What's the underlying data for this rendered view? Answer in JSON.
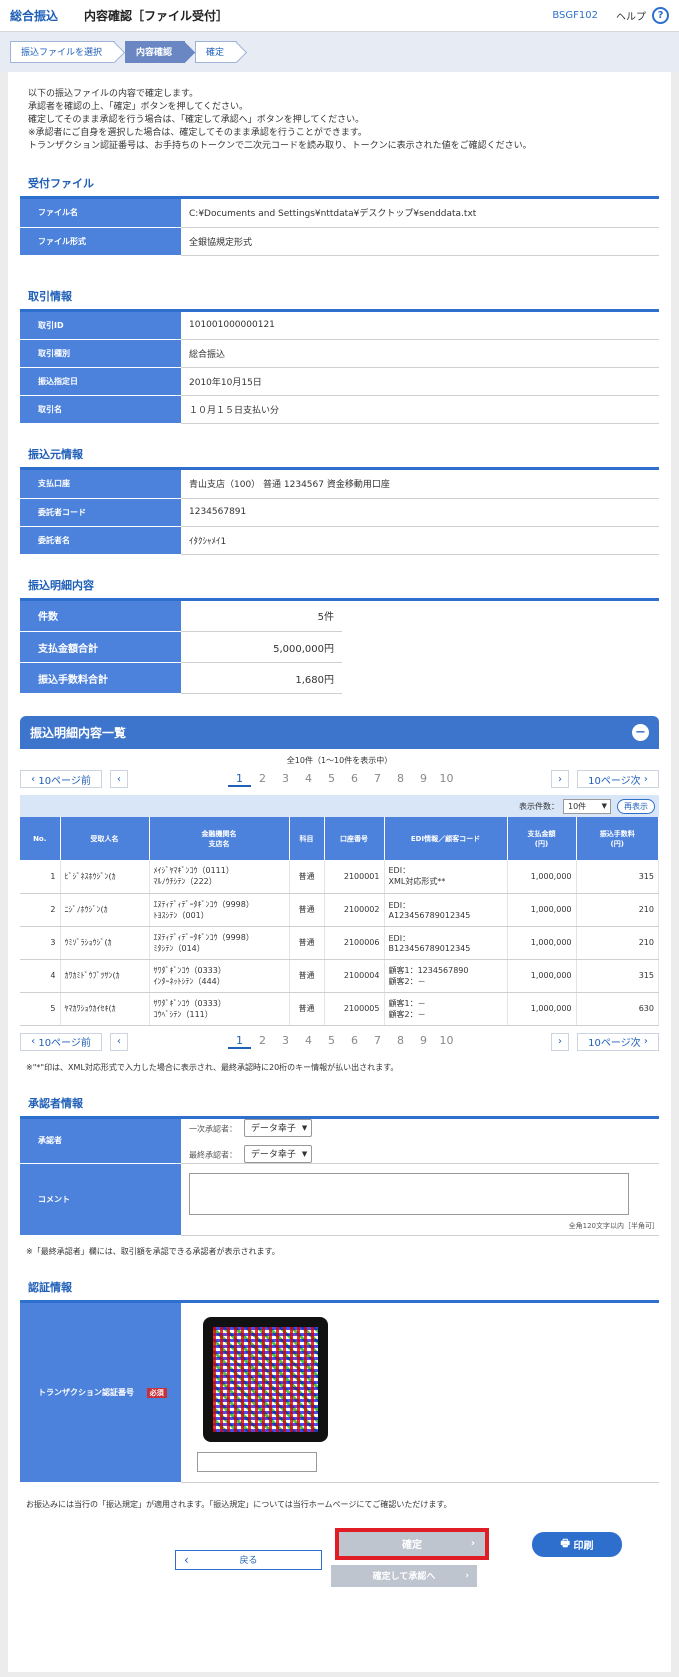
{
  "header": {
    "app_title": "総合振込",
    "page_title": "内容確認［ファイル受付］",
    "screen_id": "BSGF102",
    "help_label": "ヘルプ",
    "help_icon": "?"
  },
  "steps": [
    "振込ファイルを選択",
    "内容確認",
    "確定"
  ],
  "notice": [
    "以下の振込ファイルの内容で確定します。",
    "承認者を確認の上、「確定」ボタンを押してください。",
    "確定してそのまま承認を行う場合は、「確定して承認へ」ボタンを押してください。",
    "※承認者にご自身を選択した場合は、確定してそのまま承認を行うことができます。",
    "トランザクション認証番号は、お手持ちのトークンで二次元コードを読み取り、トークンに表示された値をご確認ください。"
  ],
  "file_section": {
    "title": "受付ファイル",
    "rows": [
      {
        "label": "ファイル名",
        "value": "C:¥Documents and Settings¥nttdata¥デスクトップ¥senddata.txt"
      },
      {
        "label": "ファイル形式",
        "value": "全銀協規定形式"
      }
    ]
  },
  "trade_section": {
    "title": "取引情報",
    "rows": [
      {
        "label": "取引ID",
        "value": "101001000000121"
      },
      {
        "label": "取引種別",
        "value": "総合振込"
      },
      {
        "label": "振込指定日",
        "value": "2010年10月15日"
      },
      {
        "label": "取引名",
        "value": "１０月１５日支払い分"
      }
    ]
  },
  "source_section": {
    "title": "振込元情報",
    "rows": [
      {
        "label": "支払口座",
        "value": "青山支店（100） 普通 1234567 資金移動用口座"
      },
      {
        "label": "委託者コード",
        "value": "1234567891"
      },
      {
        "label": "委託者名",
        "value": "ｲﾀｸｼｬﾒｲ1"
      }
    ]
  },
  "detail_section": {
    "title": "振込明細内容",
    "rows": [
      {
        "label": "件数",
        "value": "5件"
      },
      {
        "label": "支払金額合計",
        "value": "5,000,000円"
      },
      {
        "label": "振込手数料合計",
        "value": "1,680円"
      }
    ]
  },
  "list_section": {
    "title": "振込明細内容一覧",
    "collapse_icon": "minus-icon",
    "count_text": "全10件（1〜10件を表示中）",
    "prev10": "10ページ前",
    "next10": "10ページ次",
    "pages": [
      "1",
      "2",
      "3",
      "4",
      "5",
      "6",
      "7",
      "8",
      "9",
      "10"
    ],
    "display_count_label": "表示件数：",
    "display_count_value": "10件",
    "redisplay_label": "再表示",
    "columns": [
      "No.",
      "受取人名",
      "金融機関名\n支店名",
      "科目",
      "口座番号",
      "EDI情報／顧客コード",
      "支払金額\n(円)",
      "振込手数料\n(円)"
    ],
    "rows": [
      {
        "no": "1",
        "name": "ﾋﾞｼﾞﾈｽﾎｳｼﾞﾝ(ｶ",
        "bank": "ﾒｲｼﾞﾔﾏｷﾞﾝｺｳ（0111）",
        "branch": "ﾏﾙﾉｳﾁｼﾃﾝ（222）",
        "type": "普通",
        "account": "2100001",
        "edi1": "EDI：",
        "edi2": "XML対応形式**",
        "amount": "1,000,000",
        "fee": "315"
      },
      {
        "no": "2",
        "name": "ﾆｼﾞﾉﾎｳｼﾞﾝ(ｶ",
        "bank": "ｴﾇﾃｨﾃﾞｨﾃﾞｰﾀｷﾞﾝｺｳ（9998）",
        "branch": "ﾄﾖｽｼﾃﾝ（001）",
        "type": "普通",
        "account": "2100002",
        "edi1": "EDI：",
        "edi2": "A123456789012345",
        "amount": "1,000,000",
        "fee": "210"
      },
      {
        "no": "3",
        "name": "ｳﾐｿﾞﾗｼｮｳｼﾞ(ｶ",
        "bank": "ｴﾇﾃｨﾃﾞｨﾃﾞｰﾀｷﾞﾝｺｳ（9998）",
        "branch": "ﾐﾀｼﾃﾝ（014）",
        "type": "普通",
        "account": "2100006",
        "edi1": "EDI：",
        "edi2": "B123456789012345",
        "amount": "1,000,000",
        "fee": "210"
      },
      {
        "no": "4",
        "name": "ｶﾜｶﾐﾄﾞｳﾌﾞﾂｻﾝ(ｶ",
        "bank": "ｻﾜﾀﾞｷﾞﾝｺｳ（0333）",
        "branch": "ｲﾝﾀｰﾈｯﾄｼﾃﾝ（444）",
        "type": "普通",
        "account": "2100004",
        "edi1": "顧客1：1234567890",
        "edi2": "顧客2：－",
        "amount": "1,000,000",
        "fee": "315"
      },
      {
        "no": "5",
        "name": "ﾔﾏｶﾜｼｮｳｶｲｾｷ(ｶ",
        "bank": "ｻﾜﾀﾞｷﾞﾝｺｳ（0333）",
        "branch": "ｺｳﾍﾞｼﾃﾝ（111）",
        "type": "普通",
        "account": "2100005",
        "edi1": "顧客1：－",
        "edi2": "顧客2：－",
        "amount": "1,000,000",
        "fee": "630"
      }
    ],
    "footnote": "※\"*\"印は、XML対応形式で入力した場合に表示され、最終承認時に20桁のキー情報が払い出されます。"
  },
  "approver_section": {
    "title": "承認者情報",
    "label": "承認者",
    "first_label": "一次承認者：",
    "first_value": "データ幸子",
    "final_label": "最終承認者：",
    "final_value": "データ幸子",
    "comment_label": "コメント",
    "comment_limit": "全角120文字以内［半角可］",
    "note": "※「最終承認者」欄には、取引額を承認できる承認者が表示されます。"
  },
  "auth_section": {
    "title": "認証情報",
    "label": "トランザクション認証番号",
    "required": "必須"
  },
  "bottom": {
    "note": "お振込みには当行の「振込規定」が適用されます。「振込規定」については当行ホームページにてご確認いただけます。",
    "confirm": "確定",
    "print": "印刷",
    "back": "戻る",
    "confirm_approve": "確定して承認へ"
  }
}
